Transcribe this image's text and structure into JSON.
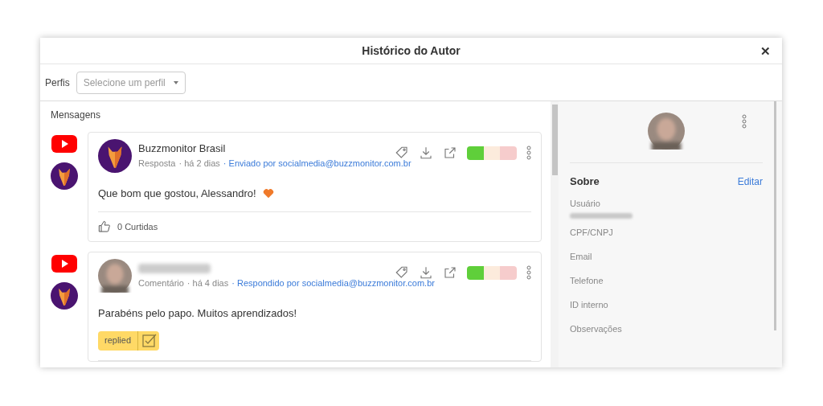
{
  "dialog": {
    "title": "Histórico do Autor",
    "close": "✕"
  },
  "profiles": {
    "label": "Perfis",
    "placeholder": "Selecione um perfil"
  },
  "messages_heading": "Mensagens",
  "messages": [
    {
      "author": "Buzzmonitor Brasil",
      "avatar": {
        "kind": "brand"
      },
      "type": "Resposta",
      "time": "· há 2 dias",
      "handled_by": "· Enviado por socialmedia@buzzmonitor.com.br",
      "sentiment": [
        {
          "selected": true
        },
        {
          "selected": false
        },
        {
          "selected": false
        }
      ],
      "text": "Que bom que gostou, Alessandro!",
      "heart": true,
      "likes": "0 Curtidas"
    },
    {
      "avatar": {
        "kind": "photo"
      },
      "type": "Comentário",
      "time": "· há 4 dias",
      "handled_by": "· Respondido por socialmedia@buzzmonitor.com.br",
      "sentiment": [
        {
          "selected": true
        },
        {
          "selected": false
        },
        {
          "selected": false
        }
      ],
      "text": "Parabéns pelo papo. Muitos aprendizados!",
      "heart": false,
      "tags": [
        {
          "label": "replied",
          "checked": true
        }
      ]
    }
  ],
  "about": {
    "title": "Sobre",
    "edit": "Editar",
    "fields": [
      {
        "label": "Usuário",
        "blurred_value": true
      },
      {
        "label": "CPF/CNPJ",
        "blurred_value": false
      },
      {
        "label": "Email",
        "blurred_value": false
      },
      {
        "label": "Telefone",
        "blurred_value": false
      },
      {
        "label": "ID interno",
        "blurred_value": false
      },
      {
        "label": "Observações",
        "blurred_value": false
      }
    ]
  }
}
